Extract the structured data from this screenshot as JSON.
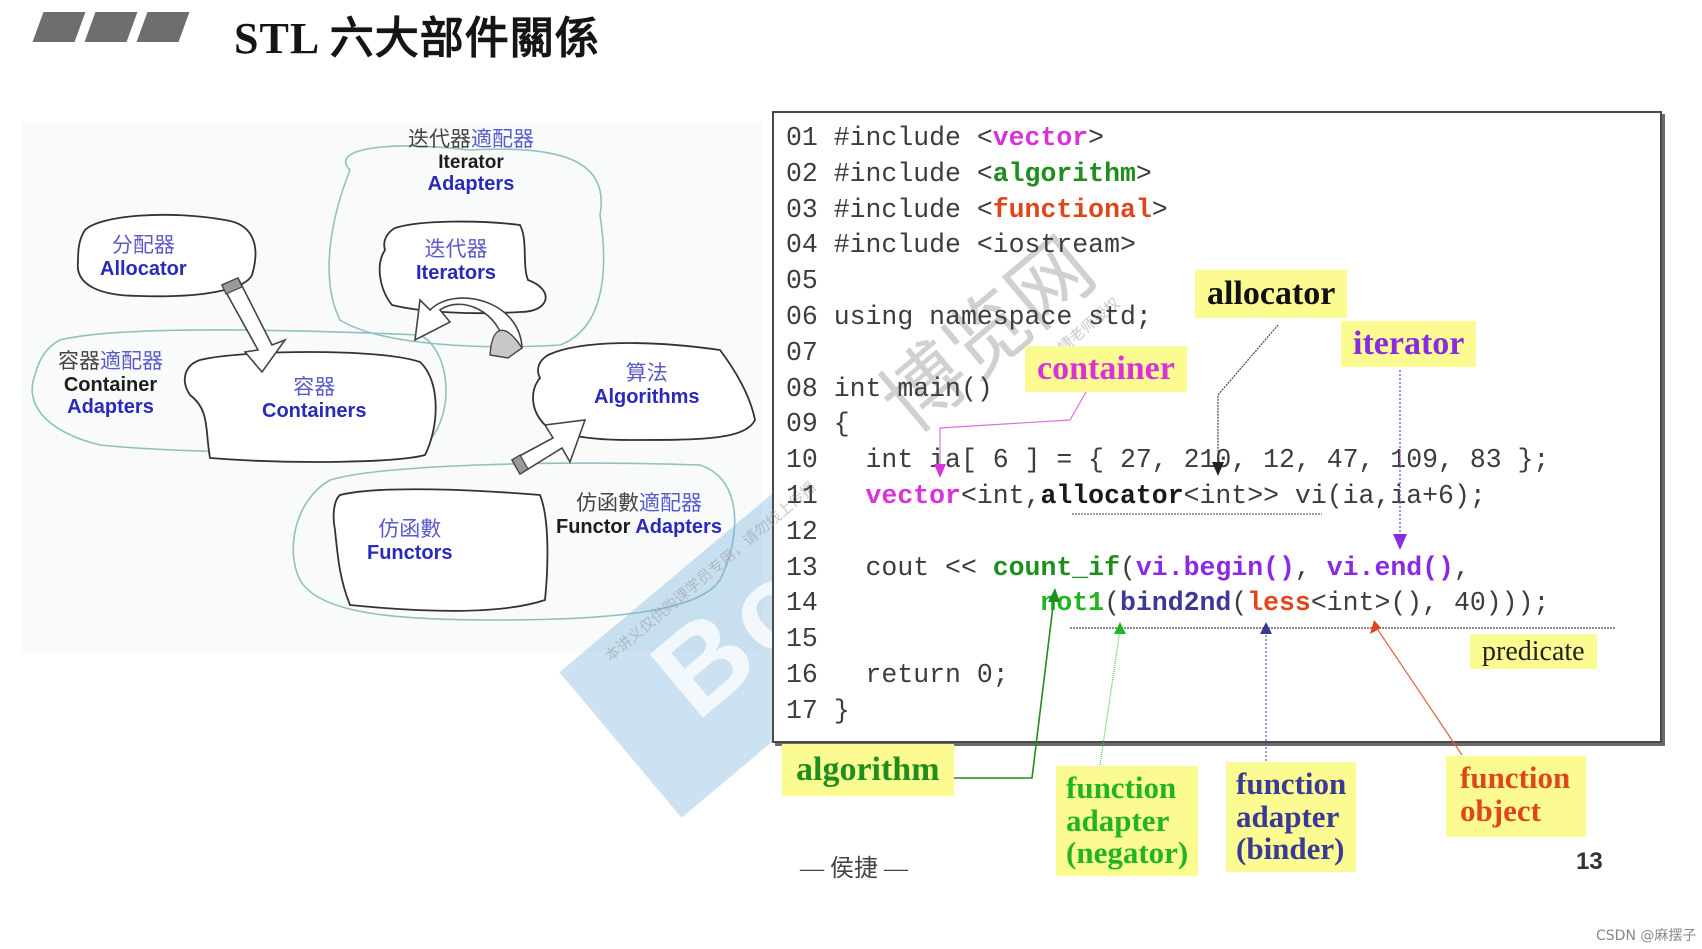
{
  "title": {
    "text": "STL 六大部件關係",
    "bar_count": 3
  },
  "diagram": {
    "components": {
      "allocator": {
        "cn": "分配器",
        "en": "Allocator"
      },
      "iterator_adapters": {
        "cn_a": "迭代器",
        "cn_b": "適配器",
        "en_a": "Iterator",
        "en_b": "Adapters"
      },
      "iterators": {
        "cn": "迭代器",
        "en": "Iterators"
      },
      "container_adapters": {
        "cn_a": "容器",
        "cn_b": "適配器",
        "en_a": "Container",
        "en_b": "Adapters"
      },
      "containers": {
        "cn": "容器",
        "en": "Containers"
      },
      "algorithms": {
        "cn": "算法",
        "en": "Algorithms"
      },
      "functors": {
        "cn": "仿函數",
        "en": "Functors"
      },
      "functor_adapters": {
        "cn_a": "仿函數",
        "cn_b": "適配器",
        "en_a": "Functor",
        "en_b": "Adapters"
      }
    }
  },
  "code": {
    "lines": [
      {
        "num": "01",
        "parts": [
          [
            "#include <",
            ""
          ],
          [
            "vector",
            "k-pink"
          ],
          [
            ">",
            ""
          ]
        ]
      },
      {
        "num": "02",
        "parts": [
          [
            "#include <",
            ""
          ],
          [
            "algorithm",
            "k-green"
          ],
          [
            ">",
            ""
          ]
        ]
      },
      {
        "num": "03",
        "parts": [
          [
            "#include <",
            ""
          ],
          [
            "functional",
            "k-red"
          ],
          [
            ">",
            ""
          ]
        ]
      },
      {
        "num": "04",
        "parts": [
          [
            "#include <iostream>",
            ""
          ]
        ]
      },
      {
        "num": "05",
        "parts": []
      },
      {
        "num": "06",
        "parts": [
          [
            "using namespace std;",
            ""
          ]
        ]
      },
      {
        "num": "07",
        "parts": []
      },
      {
        "num": "08",
        "parts": [
          [
            "int main()",
            ""
          ]
        ]
      },
      {
        "num": "09",
        "parts": [
          [
            "{",
            ""
          ]
        ]
      },
      {
        "num": "10",
        "parts": [
          [
            "  int ia[ 6 ] = { 27, 210, 12, 47, 109, 83 };",
            ""
          ]
        ]
      },
      {
        "num": "11",
        "parts": [
          [
            "  ",
            ""
          ],
          [
            "vector",
            "k-pink"
          ],
          [
            "<int,",
            ""
          ],
          [
            "allocator",
            "k-black"
          ],
          [
            "<int>> vi(ia,ia+6);",
            ""
          ]
        ]
      },
      {
        "num": "12",
        "parts": []
      },
      {
        "num": "13",
        "parts": [
          [
            "  cout << ",
            ""
          ],
          [
            "count_if",
            "k-green"
          ],
          [
            "(",
            ""
          ],
          [
            "vi.begin()",
            "k-purple"
          ],
          [
            ", ",
            ""
          ],
          [
            "vi.end()",
            "k-purple"
          ],
          [
            ",",
            ""
          ]
        ]
      },
      {
        "num": "14",
        "parts": [
          [
            "             ",
            ""
          ],
          [
            "not1",
            "k-lgreen"
          ],
          [
            "(",
            ""
          ],
          [
            "bind2nd",
            "k-navy"
          ],
          [
            "(",
            ""
          ],
          [
            "less",
            "k-red"
          ],
          [
            "<int>(), 40)));",
            ""
          ]
        ]
      },
      {
        "num": "15",
        "parts": []
      },
      {
        "num": "16",
        "parts": [
          [
            "  return 0;",
            ""
          ]
        ]
      },
      {
        "num": "17",
        "parts": [
          [
            "}",
            ""
          ]
        ]
      }
    ]
  },
  "annotations": {
    "allocator": {
      "text": "allocator",
      "color": "#111111"
    },
    "container": {
      "text": "container",
      "color": "#d932d9"
    },
    "iterator": {
      "text": "iterator",
      "color": "#8a2be2"
    },
    "predicate": {
      "text": "predicate",
      "color": "#222222"
    },
    "algorithm": {
      "text": "algorithm",
      "color": "#1f8e1f"
    },
    "negator": {
      "line1": "function",
      "line2": "adapter",
      "line3": "(negator)",
      "color": "#22b422"
    },
    "binder": {
      "line1": "function",
      "line2": "adapter",
      "line3": "(binder)",
      "color": "#3a3a94"
    },
    "function_object": {
      "line1": "function",
      "line2": "object",
      "color": "#e0461c"
    }
  },
  "watermark": {
    "brand": "Boolan",
    "cn": "博览网",
    "notice_1": "本讲义仅供购课学员专用，请勿线上传播",
    "notice_2": "与侯捷老师授权"
  },
  "footer": {
    "author": "— 侯捷 —",
    "page_number": "13",
    "source_mark": "CSDN @麻摆子"
  }
}
